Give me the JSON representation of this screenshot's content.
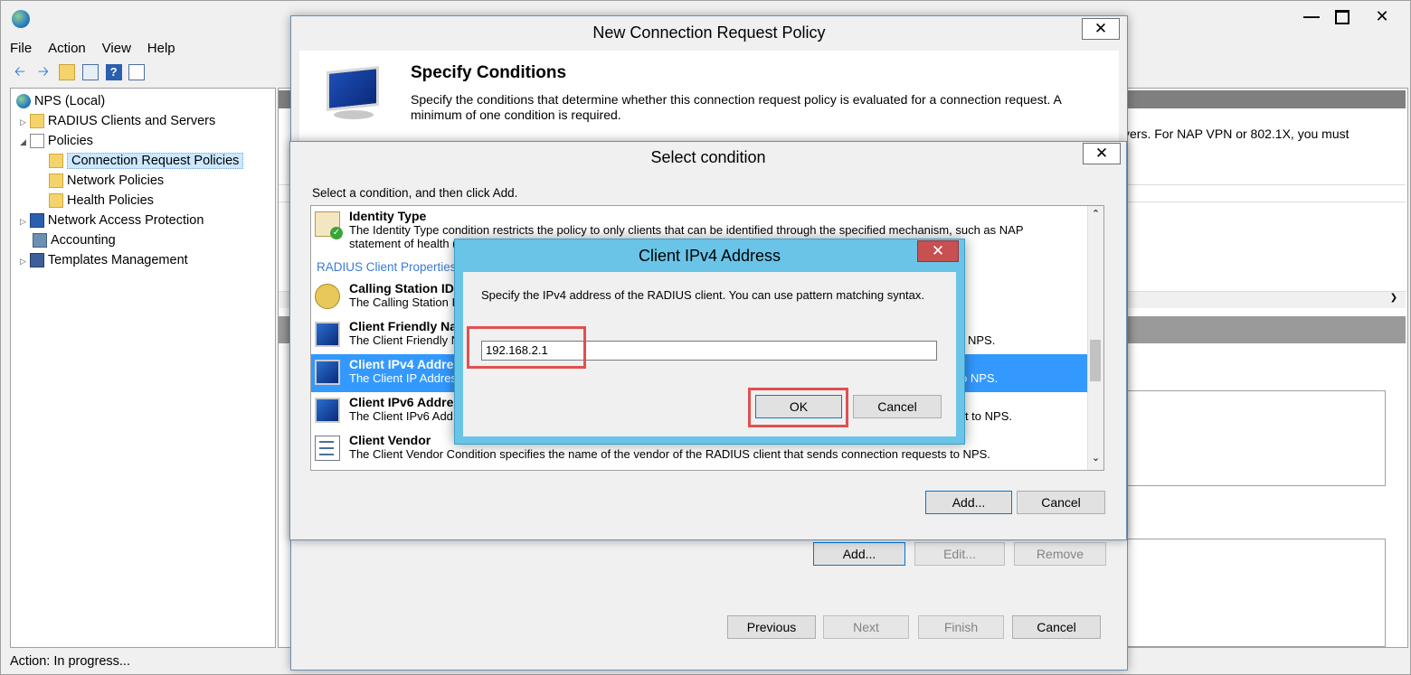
{
  "main_window": {
    "menu": [
      "File",
      "Action",
      "View",
      "Help"
    ],
    "tree": [
      {
        "label": "NPS (Local)"
      },
      {
        "label": "RADIUS Clients and Servers"
      },
      {
        "label": "Policies"
      },
      {
        "label": "Connection Request Policies"
      },
      {
        "label": "Network Policies"
      },
      {
        "label": "Health Policies"
      },
      {
        "label": "Network Access Protection"
      },
      {
        "label": "Accounting"
      },
      {
        "label": "Templates Management"
      }
    ],
    "right_snippet": "vers. For NAP VPN or 802.1X, you must",
    "status": "Action:  In progress..."
  },
  "wizard": {
    "title": "New Connection Request Policy",
    "heading": "Specify Conditions",
    "description": "Specify the conditions that determine whether this connection request policy is evaluated for a connection request. A minimum of one condition is required.",
    "buttons": {
      "add": "Add...",
      "edit": "Edit...",
      "remove": "Remove",
      "previous": "Previous",
      "next": "Next",
      "finish": "Finish",
      "cancel": "Cancel"
    }
  },
  "select_condition": {
    "title": "Select condition",
    "instruction": "Select a condition, and then click Add.",
    "category_radius": "RADIUS Client Properties",
    "conditions": [
      {
        "name": "Identity Type",
        "desc": "The Identity Type condition restricts the policy to only clients that can be identified through the specified mechanism, such as NAP",
        "desc2": "statement of health ("
      },
      {
        "name": "Calling Station ID",
        "desc": "The Calling Station I"
      },
      {
        "name": "Client Friendly Na",
        "desc": "The Client Friendly N",
        "desc_tail": "NPS."
      },
      {
        "name": "Client IPv4 Addres",
        "desc": "The Client IP Addres",
        "desc_tail": "o NPS."
      },
      {
        "name": "Client IPv6 Addres",
        "desc": "The Client IPv6 Add",
        "desc_tail": "uest to NPS."
      },
      {
        "name": "Client Vendor",
        "desc": "The Client Vendor Condition specifies the name of the vendor of the RADIUS client that sends connection requests to NPS."
      }
    ],
    "buttons": {
      "add": "Add...",
      "cancel": "Cancel"
    }
  },
  "ipv4_dialog": {
    "title": "Client IPv4 Address",
    "label": "Specify the IPv4 address of the RADIUS client. You can use pattern matching syntax.",
    "value": "192.168.2.1",
    "buttons": {
      "ok": "OK",
      "cancel": "Cancel"
    }
  },
  "colors": {
    "selection": "#3399ff",
    "dialog_accent": "#69c4e8",
    "highlight_box": "#e05050",
    "close_red": "#c75050"
  }
}
